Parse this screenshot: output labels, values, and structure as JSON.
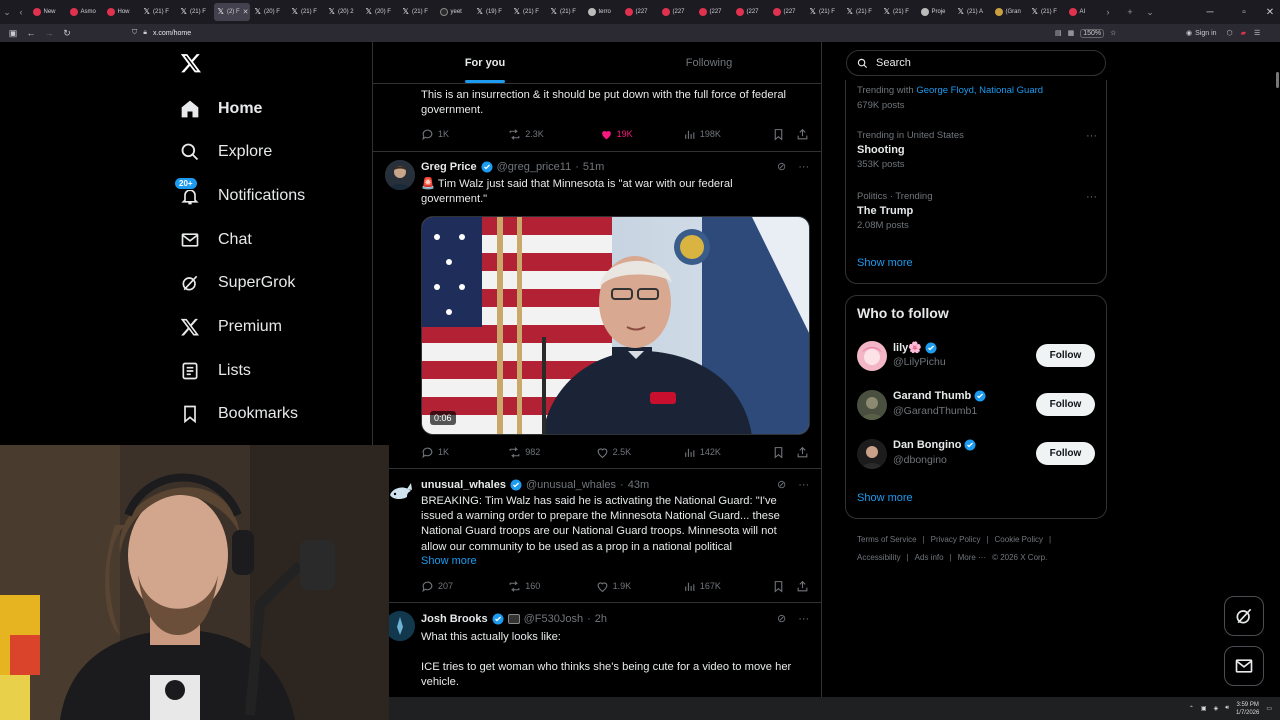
{
  "browser": {
    "tabs": [
      {
        "label": "New",
        "icon": "red"
      },
      {
        "label": "Asmo",
        "icon": "red"
      },
      {
        "label": "How",
        "icon": "red"
      },
      {
        "label": "(21) F",
        "icon": "x"
      },
      {
        "label": "(21) F",
        "icon": "x"
      },
      {
        "label": "(2) F",
        "icon": "x",
        "active": true
      },
      {
        "label": "(20) F",
        "icon": "x"
      },
      {
        "label": "(21) F",
        "icon": "x"
      },
      {
        "label": "(20) 2",
        "icon": "x"
      },
      {
        "label": "(20) F",
        "icon": "x"
      },
      {
        "label": "(21) F",
        "icon": "x"
      },
      {
        "label": "yeet",
        "icon": "yt"
      },
      {
        "label": "(19) F",
        "icon": "x"
      },
      {
        "label": "(21) F",
        "icon": "x"
      },
      {
        "label": "(21) F",
        "icon": "x"
      },
      {
        "label": "terro",
        "icon": "grey"
      },
      {
        "label": "(227",
        "icon": "red"
      },
      {
        "label": "(227",
        "icon": "red"
      },
      {
        "label": "(227",
        "icon": "red"
      },
      {
        "label": "(227",
        "icon": "red"
      },
      {
        "label": "(227",
        "icon": "red"
      },
      {
        "label": "(21) F",
        "icon": "x"
      },
      {
        "label": "(21) F",
        "icon": "x"
      },
      {
        "label": "(21) F",
        "icon": "x"
      },
      {
        "label": "Proje",
        "icon": "grey"
      },
      {
        "label": "(21) A",
        "icon": "x"
      },
      {
        "label": "(Gran",
        "icon": "gold"
      },
      {
        "label": "(21) F",
        "icon": "x"
      },
      {
        "label": "AI",
        "icon": "red"
      }
    ],
    "url": "x.com/home",
    "zoom": "150%",
    "signin": "Sign in"
  },
  "sidebar": {
    "logo": "X",
    "items": [
      {
        "label": "Home",
        "icon": "home-icon",
        "active": true
      },
      {
        "label": "Explore",
        "icon": "search-icon"
      },
      {
        "label": "Notifications",
        "icon": "bell-icon",
        "badge": "20+"
      },
      {
        "label": "Chat",
        "icon": "mail-icon"
      },
      {
        "label": "SuperGrok",
        "icon": "grok-icon"
      },
      {
        "label": "Premium",
        "icon": "x-icon"
      },
      {
        "label": "Lists",
        "icon": "list-icon"
      },
      {
        "label": "Bookmarks",
        "icon": "bookmark-icon"
      }
    ]
  },
  "feed": {
    "tabs": [
      "For you",
      "Following"
    ],
    "posts": [
      {
        "text": "This is an insurrection & it should be put down with the full force of federal government.",
        "replies": "1K",
        "reposts": "2.3K",
        "likes": "19K",
        "views": "198K",
        "liked": true
      },
      {
        "name": "Greg Price",
        "handle": "@greg_price11",
        "time": "51m",
        "text": "🚨 Tim Walz just said that Minnesota is \"at war with our federal government.\"",
        "video_time": "0:06",
        "replies": "1K",
        "reposts": "982",
        "likes": "2.5K",
        "views": "142K"
      },
      {
        "name": "unusual_whales",
        "handle": "@unusual_whales",
        "time": "43m",
        "text": "BREAKING: Tim Walz has said he is activating the National Guard: \"I've issued a warning order to prepare the Minnesota National Guard... these National Guard troops are our National Guard troops. Minnesota will not allow our community to be used as a prop in a national political",
        "show_more": "Show more",
        "replies": "207",
        "reposts": "160",
        "likes": "1.9K",
        "views": "167K"
      },
      {
        "name": "Josh Brooks",
        "handle": "@F530Josh",
        "time": "2h",
        "text1": "What this actually looks like:",
        "text2": "ICE tries to get woman who thinks she's being cute for a video to move her vehicle."
      }
    ]
  },
  "right": {
    "search_placeholder": "Search",
    "trends": [
      {
        "meta_prefix": "Trending with",
        "links": "George Floyd, National Guard",
        "posts": "679K posts"
      },
      {
        "meta": "Trending in United States",
        "title": "Shooting",
        "posts": "353K posts"
      },
      {
        "meta": "Politics · Trending",
        "title": "The Trump",
        "posts": "2.08M posts"
      }
    ],
    "trends_show_more": "Show more",
    "who_to_follow_title": "Who to follow",
    "follow": [
      {
        "name": "lily🌸",
        "handle": "@LilyPichu",
        "button": "Follow"
      },
      {
        "name": "Garand Thumb",
        "handle": "@GarandThumb1",
        "button": "Follow"
      },
      {
        "name": "Dan Bongino",
        "handle": "@dbongino",
        "button": "Follow"
      }
    ],
    "follow_show_more": "Show more",
    "footer_row1": [
      "Terms of Service",
      "|",
      "Privacy Policy",
      "|",
      "Cookie Policy",
      "|"
    ],
    "footer_row2": [
      "Accessibility",
      "|",
      "Ads info",
      "|",
      "More ···",
      "© 2026 X Corp."
    ]
  },
  "taskbar": {
    "time": "3:59 PM",
    "date": "1/7/2026"
  }
}
